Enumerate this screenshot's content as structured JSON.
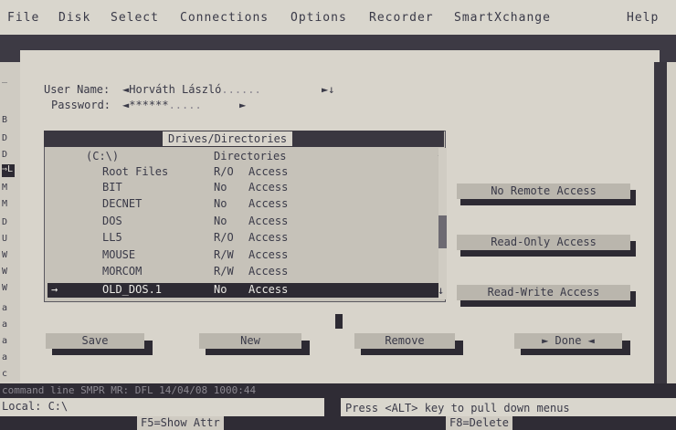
{
  "menu": [
    "File",
    "Disk",
    "Select",
    "Connections",
    "Options",
    "Recorder",
    "SmartXchange",
    "Help"
  ],
  "left_strip": [
    "_",
    "B",
    "D",
    "D",
    "⇒L",
    "M",
    "M",
    "D",
    "U",
    "W",
    "W",
    "W",
    "a",
    "a",
    "a",
    "a",
    "c"
  ],
  "login": {
    "user_label": "User Name:",
    "user_value": "◄Horváth László",
    "user_fill": "......",
    "user_end": "►↓",
    "password_label": "Password:",
    "password_value": "◄******",
    "password_fill": ".....",
    "password_end": "►"
  },
  "panel": {
    "title": "Drives/Directories",
    "header_drive": "(C:\\)",
    "header_dirs": "Directories",
    "scroll_up": "↑",
    "scroll_down": "↓",
    "rows": [
      {
        "name": "Root Files",
        "perm": "R/O",
        "label": "Access"
      },
      {
        "name": "BIT",
        "perm": "No",
        "label": "Access"
      },
      {
        "name": "DECNET",
        "perm": "No",
        "label": "Access"
      },
      {
        "name": "DOS",
        "perm": "No",
        "label": "Access"
      },
      {
        "name": "LL5",
        "perm": "R/O",
        "label": "Access"
      },
      {
        "name": "MOUSE",
        "perm": "R/W",
        "label": "Access"
      },
      {
        "name": "MORCOM",
        "perm": "R/W",
        "label": "Access"
      },
      {
        "name": "OLD_DOS.1",
        "perm": "No",
        "label": "Access",
        "marker": "→"
      }
    ]
  },
  "access_buttons": {
    "no_remote": "No Remote Access",
    "read_only": "Read-Only Access",
    "read_write": "Read-Write Access"
  },
  "bottom_buttons": {
    "save": "Save",
    "new": "New",
    "remove": "Remove",
    "done": "► Done ◄"
  },
  "status": {
    "command": "command line SMPR MR: DFL 14/04/08 1000:44",
    "local": "Local: C:\\",
    "hint": "Press <ALT> key to pull down menus",
    "f_show": "F5=Show Attr",
    "f_delete": "F8=Delete"
  },
  "colors": {
    "background": "#d4d0c6",
    "dark_bar": "#2f2c35",
    "selection": "#2d2a33",
    "button": "#bab6ad"
  }
}
